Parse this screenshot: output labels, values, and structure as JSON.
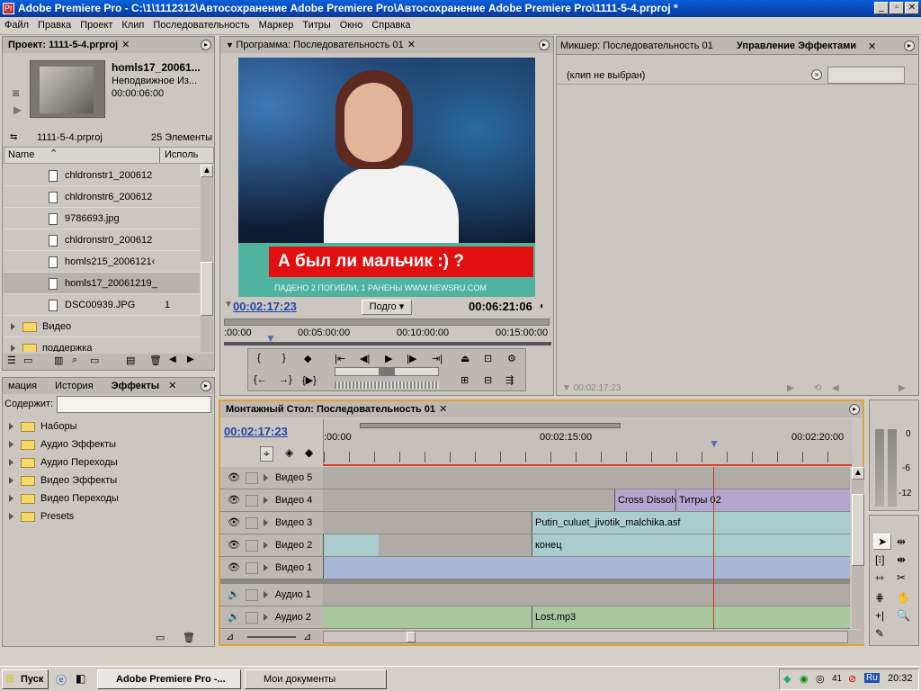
{
  "window": {
    "title": "Adobe Premiere Pro - C:\\1\\1112312\\Автосохранение Adobe Premiere Pro\\Автосохранение Adobe Premiere Pro\\1111-5-4.prproj *"
  },
  "menu": [
    "Файл",
    "Правка",
    "Проект",
    "Клип",
    "Последовательность",
    "Маркер",
    "Титры",
    "Окно",
    "Справка"
  ],
  "project": {
    "tab": "Проект: 1111-5-4.prproj",
    "preview_name": "homls17_20061...",
    "preview_type": "Неподвижное Из...",
    "preview_duration": "00:00:06:00",
    "file": "1111-5-4.prproj",
    "count": "25 Элементы",
    "col_name": "Name",
    "col_usage": "Исполь",
    "items": [
      {
        "name": "chldronstr1_200612",
        "use": "",
        "type": "file"
      },
      {
        "name": "chldronstr6_200612",
        "use": "",
        "type": "file"
      },
      {
        "name": "9786693.jpg",
        "use": "",
        "type": "file"
      },
      {
        "name": "chldronstr0_200612",
        "use": "",
        "type": "file"
      },
      {
        "name": "homls215_2006121‹",
        "use": "",
        "type": "file"
      },
      {
        "name": "homls17_20061219_",
        "use": "",
        "type": "file"
      },
      {
        "name": "DSC00939.JPG",
        "use": "1",
        "type": "file"
      },
      {
        "name": "Видео",
        "use": "",
        "type": "folder"
      },
      {
        "name": "поддержка",
        "use": "",
        "type": "folder"
      }
    ]
  },
  "effects": {
    "tabs": [
      "мация",
      "История",
      "Эффекты"
    ],
    "contains_label": "Содержит:",
    "folders": [
      "Наборы",
      "Аудио Эффекты",
      "Аудио Переходы",
      "Видео Эффекты",
      "Видео Переходы",
      "Presets"
    ]
  },
  "program": {
    "tab": "Программа: Последовательность 01",
    "subtitle": "А был ли мальчик :) ?",
    "ticker": "ПАДЕНО 2 ПОГИБЛИ, 1 РАНЕНЫ   WWW.NEWSRU.COM",
    "timecode": "00:02:17:23",
    "fit": "Подго",
    "duration": "00:06:21:06",
    "ruler": [
      ":00:00",
      "00:05:00:00",
      "00:10:00:00",
      "00:15:00:00"
    ]
  },
  "mixer": {
    "tab": "Микшер: Последовательность 01"
  },
  "effect_controls": {
    "tab": "Управление Эффектами",
    "noclip": "(клип не выбран)",
    "timecode": "00:02:17:23"
  },
  "timeline": {
    "tab": "Монтажный Стол: Последовательность 01",
    "timecode": "00:02:17:23",
    "ruler": [
      ":00:00",
      "00:02:15:00",
      "00:02:20:00"
    ],
    "video_tracks": [
      "Видео 5",
      "Видео 4",
      "Видео 3",
      "Видео 2",
      "Видео 1"
    ],
    "audio_tracks": [
      "Аудио 1",
      "Аудио 2"
    ],
    "clips": {
      "cross": "Cross Dissolv",
      "titles": "Титры  02",
      "putin": "Putin_culuet_jivotik_malchika.asf",
      "konec": "конец",
      "lost": "Lost.mp3"
    }
  },
  "meter": {
    "labels": [
      "0",
      "-6",
      "-12"
    ]
  },
  "taskbar": {
    "start": "Пуск",
    "tasks": [
      "Adobe Premiere Pro -...",
      "Мои документы"
    ],
    "tray_num": "41",
    "lang": "Ru",
    "clock": "20:32"
  },
  "colors": {
    "clip_video": "#a9cccc",
    "clip_blue": "#a6b8d6",
    "clip_purple": "#b3a7cf",
    "clip_audio": "#a9c8a0",
    "playhead": "#d04020"
  }
}
